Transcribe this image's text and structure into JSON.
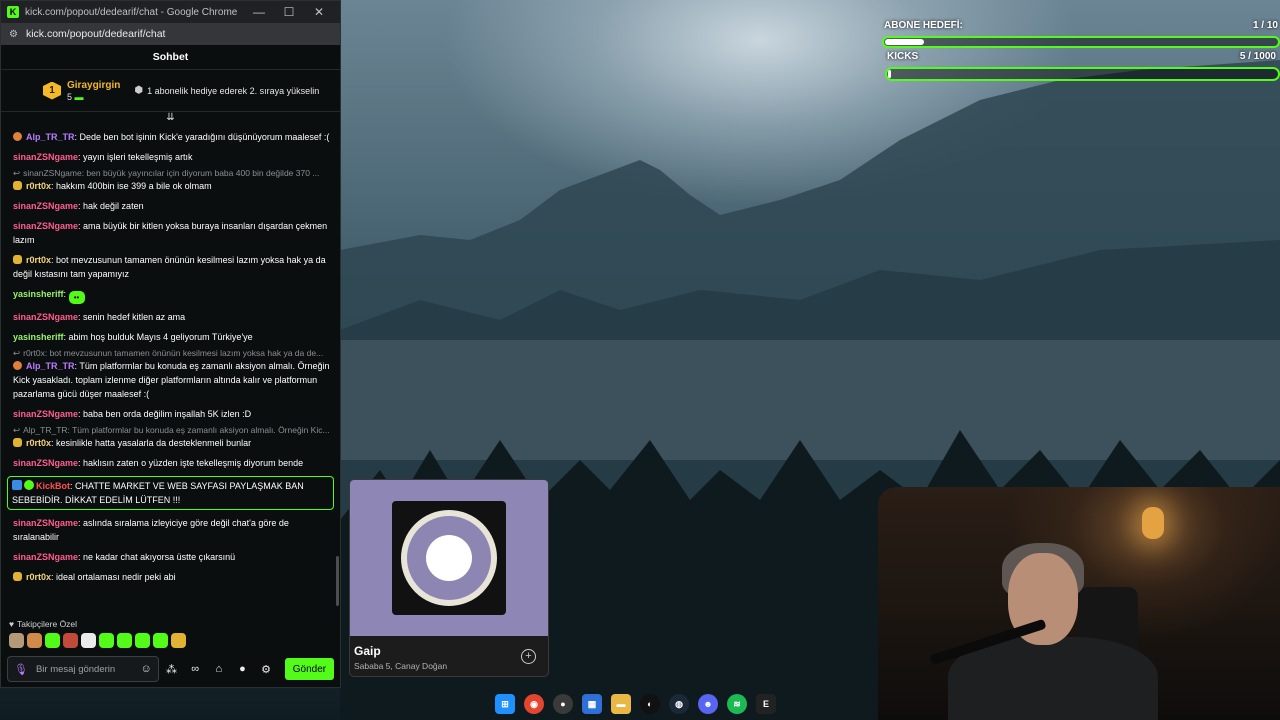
{
  "window": {
    "title": "kick.com/popout/dedearif/chat - Google Chrome",
    "url": "kick.com/popout/dedearif/chat"
  },
  "chat": {
    "header": "Sohbet",
    "pinned": {
      "rank": "1",
      "username": "Giraygirgin",
      "count": "5",
      "message": "1 abonelik hediye ederek 2. sıraya yükselin"
    },
    "messages": [
      {
        "user": "Alp_TR_TR",
        "color": "purple",
        "badge": "orange",
        "text": ": Dede ben bot işinin Kick'e yaradığını düşünüyorum maalesef :("
      },
      {
        "user": "sinanZSNgame",
        "color": "pink",
        "text": ": yayın işleri tekelleşmiş artık"
      },
      {
        "reply": "sinanZSNgame: ben büyük yayıncılar için diyorum baba 400 bin değilde 370 ...",
        "user": "r0rt0x",
        "color": "yellow",
        "badge": "gold",
        "text": ": hakkım 400bin ise 399 a bile ok olmam"
      },
      {
        "user": "sinanZSNgame",
        "color": "pink",
        "text": ": hak değil zaten"
      },
      {
        "user": "sinanZSNgame",
        "color": "pink",
        "text": ": ama büyük bir kitlen yoksa buraya insanları dışardan çekmen lazım"
      },
      {
        "user": "r0rt0x",
        "color": "yellow",
        "badge": "gold",
        "text": ": bot mevzusunun tamamen önünün kesilmesi lazım yoksa hak ya da değil kıstasını tam yapamıyız"
      },
      {
        "user": "yasinsheriff",
        "color": "green",
        "text": ":",
        "emote": true
      },
      {
        "user": "sinanZSNgame",
        "color": "pink",
        "text": ": senin hedef kitlen az ama"
      },
      {
        "user": "yasinsheriff",
        "color": "green",
        "text": ": abim hoş bulduk Mayıs 4 geliyorum Türkiye'ye"
      },
      {
        "reply": "r0rt0x: bot mevzusunun tamamen önünün kesilmesi lazım yoksa hak ya da de...",
        "user": "Alp_TR_TR",
        "color": "purple",
        "badge": "orange",
        "text": ": Tüm platformlar bu konuda eş zamanlı aksiyon almalı. Örneğin Kick yasakladı. toplam izlenme diğer platformların altında kalır ve platformun pazarlama gücü düşer maalesef :("
      },
      {
        "user": "sinanZSNgame",
        "color": "pink",
        "text": ": baba ben orda değilim inşallah 5K izlen :D"
      },
      {
        "reply": "Alp_TR_TR: Tüm platformlar bu konuda eş zamanlı aksiyon almalı. Örneğin Kic...",
        "user": "r0rt0x",
        "color": "yellow",
        "badge": "gold",
        "text": ": kesinlikle hatta yasalarla da desteklenmeli bunlar"
      },
      {
        "user": "sinanZSNgame",
        "color": "pink",
        "text": ": haklısın zaten o yüzden işte tekelleşmiş diyorum bende"
      },
      {
        "user": "KickBot",
        "color": "red",
        "highlight": true,
        "text": ": CHATTE MARKET VE WEB SAYFASI PAYLAŞMAK BAN SEBEBİDİR. DİKKAT EDELİM LÜTFEN !!!"
      },
      {
        "user": "sinanZSNgame",
        "color": "pink",
        "text": ": aslında sıralama izleyiciye göre değil chat'a göre de sıralanabilir"
      },
      {
        "user": "sinanZSNgame",
        "color": "pink",
        "text": ": ne kadar chat akıyorsa üstte çıkarsınü"
      },
      {
        "user": "r0rt0x",
        "color": "yellow",
        "badge": "gold",
        "text": ": ideal ortalaması nedir peki abi"
      }
    ],
    "followers_label": "Takipçilere Özel",
    "input_placeholder": "Bir mesaj gönderin",
    "send_label": "Gönder"
  },
  "goals": {
    "sub_goal": {
      "label": "ABONE HEDEFİ:",
      "value": "1 / 10",
      "progress": 0.1
    },
    "kicks_goal": {
      "label": "KICKS",
      "value": "5 / 1000",
      "progress": 0.005
    }
  },
  "now_playing": {
    "title": "Gaip",
    "artist": "Sababa 5, Canay Doğan"
  },
  "colors": {
    "accent": "#53fc18",
    "purple": "#b97cff",
    "pink": "#ff5d8f",
    "yellow": "#f7d57a",
    "green": "#9bf36a",
    "red": "#ff4f4f"
  },
  "taskbar_icons": [
    "windows-icon",
    "chrome-icon",
    "obs-icon",
    "store-icon",
    "folder-icon",
    "github-icon",
    "steam-icon",
    "discord-icon",
    "spotify-icon",
    "epic-icon"
  ]
}
